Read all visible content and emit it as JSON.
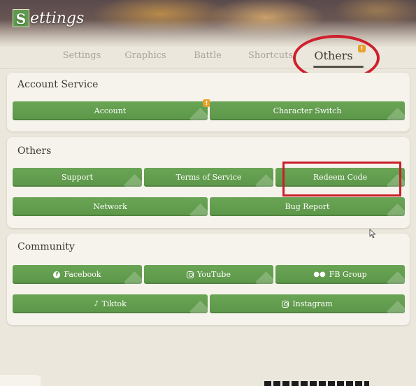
{
  "header": {
    "title_initial": "S",
    "title_rest": "ettings"
  },
  "tabs": [
    {
      "label": "Settings",
      "active": false
    },
    {
      "label": "Graphics",
      "active": false
    },
    {
      "label": "Battle",
      "active": false
    },
    {
      "label": "Shortcuts",
      "active": false
    },
    {
      "label": "Others",
      "active": true
    }
  ],
  "badge_text": "!",
  "sections": {
    "account": {
      "title": "Account Service",
      "buttons": {
        "account": "Account",
        "character_switch": "Character Switch"
      }
    },
    "others": {
      "title": "Others",
      "buttons": {
        "support": "Support",
        "terms": "Terms of Service",
        "redeem": "Redeem Code",
        "network": "Network",
        "bug_report": "Bug Report"
      }
    },
    "community": {
      "title": "Community",
      "buttons": {
        "facebook": "Facebook",
        "youtube": "YouTube",
        "fb_group": "FB Group",
        "tiktok": "Tiktok",
        "instagram": "Instagram"
      }
    }
  },
  "colors": {
    "button_green": "#5c9648",
    "highlight_red": "#cf1f2c",
    "badge_orange": "#e8a12a",
    "panel_bg": "#f6f3ec"
  }
}
